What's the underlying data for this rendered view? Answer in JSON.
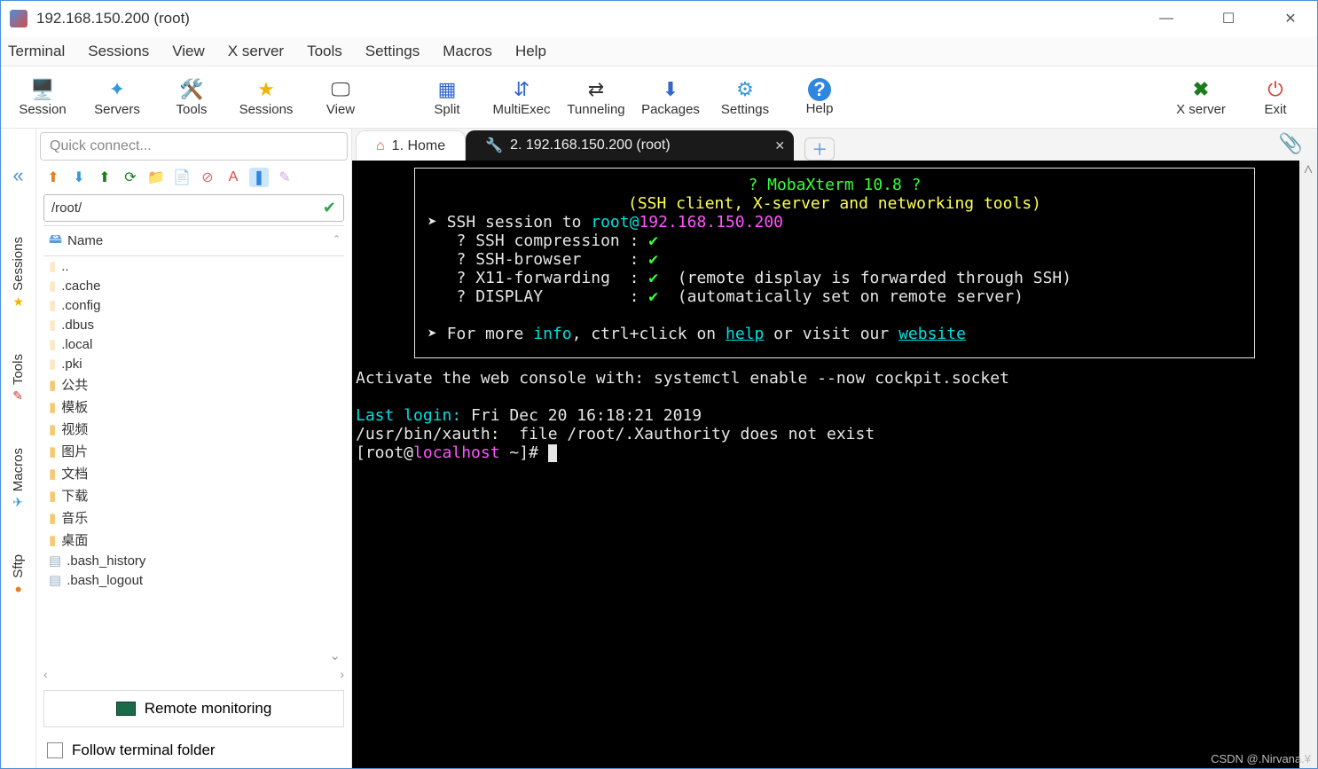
{
  "window": {
    "title": "192.168.150.200 (root)"
  },
  "menubar": [
    "Terminal",
    "Sessions",
    "View",
    "X server",
    "Tools",
    "Settings",
    "Macros",
    "Help"
  ],
  "toolbar": {
    "items": [
      {
        "label": "Session",
        "icon": "🖥️"
      },
      {
        "label": "Servers",
        "icon": "✦"
      },
      {
        "label": "Tools",
        "icon": "🛠️"
      },
      {
        "label": "Sessions",
        "icon": "★"
      },
      {
        "label": "View",
        "icon": "🖵"
      },
      {
        "label": "Split",
        "icon": "▦"
      },
      {
        "label": "MultiExec",
        "icon": "⇵"
      },
      {
        "label": "Tunneling",
        "icon": "⇄"
      },
      {
        "label": "Packages",
        "icon": "⬇"
      },
      {
        "label": "Settings",
        "icon": "⚙"
      },
      {
        "label": "Help",
        "icon": "?"
      }
    ],
    "right": [
      {
        "label": "X server",
        "icon": "✖"
      },
      {
        "label": "Exit",
        "icon": "⏻"
      }
    ]
  },
  "quick_placeholder": "Quick connect...",
  "vertical_tabs": [
    {
      "label": "Sessions",
      "icon": "★",
      "color": "#f5b301"
    },
    {
      "label": "Tools",
      "icon": "✎",
      "color": "#c0392b"
    },
    {
      "label": "Macros",
      "icon": "✈",
      "color": "#3498db"
    },
    {
      "label": "Sftp",
      "icon": "●",
      "color": "#e67e22"
    }
  ],
  "browser": {
    "path": "/root/",
    "header": "Name",
    "items": [
      {
        "name": "..",
        "icon": "pale"
      },
      {
        "name": ".cache",
        "icon": "pale"
      },
      {
        "name": ".config",
        "icon": "pale"
      },
      {
        "name": ".dbus",
        "icon": "pale"
      },
      {
        "name": ".local",
        "icon": "pale"
      },
      {
        "name": ".pki",
        "icon": "pale"
      },
      {
        "name": "公共",
        "icon": "folder"
      },
      {
        "name": "模板",
        "icon": "folder"
      },
      {
        "name": "视频",
        "icon": "folder"
      },
      {
        "name": "图片",
        "icon": "folder"
      },
      {
        "name": "文档",
        "icon": "folder"
      },
      {
        "name": "下载",
        "icon": "folder"
      },
      {
        "name": "音乐",
        "icon": "folder"
      },
      {
        "name": "桌面",
        "icon": "folder"
      },
      {
        "name": ".bash_history",
        "icon": "file"
      },
      {
        "name": ".bash_logout",
        "icon": "file"
      }
    ],
    "remote_monitoring": "Remote monitoring",
    "follow": "Follow terminal folder"
  },
  "tabs": {
    "home": "1. Home",
    "ssh": "2. 192.168.150.200 (root)"
  },
  "terminal": {
    "banner_title": "? MobaXterm 10.8 ?",
    "banner_sub": "(SSH client, X-server and networking tools)",
    "ssh_to_prefix": "SSH session to ",
    "ssh_user": "root@",
    "ssh_host": "192.168.150.200",
    "lines": {
      "comp": "? SSH compression :",
      "browser": "? SSH-browser     :",
      "x11": "? X11-forwarding  :",
      "display": "? DISPLAY         :",
      "x11_note": "(remote display is forwarded through SSH)",
      "display_note": "(automatically set on remote server)"
    },
    "more_pre": "For more ",
    "more_info": "info",
    "more_mid": ", ctrl+click on ",
    "more_help": "help",
    "more_mid2": " or visit our ",
    "more_site": "website",
    "activate": "Activate the web console with: systemctl enable --now cockpit.socket",
    "last_login_label": "Last login:",
    "last_login_value": " Fri Dec 20 16:18:21 2019",
    "xauth": "/usr/bin/xauth:  file /root/.Xauthority does not exist",
    "prompt_open": "[root@",
    "prompt_host": "localhost",
    "prompt_tail": " ~]# "
  },
  "watermark": "CSDN @.Nirvana.¥"
}
